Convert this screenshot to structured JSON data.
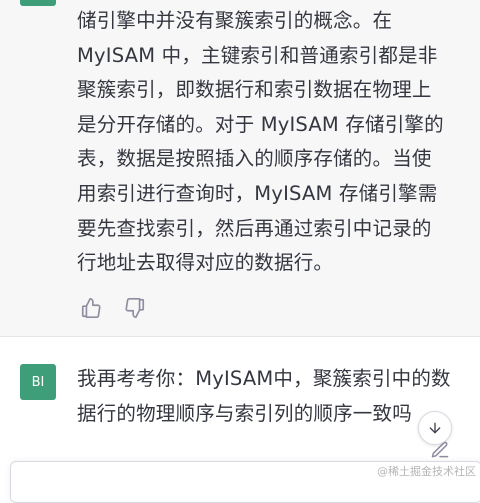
{
  "assistant": {
    "answer_lines": [
      "储引擎中并没有聚簇索引的概念。在",
      "MyISAM 中，主键索引和普通索引都是非",
      "聚簇索引，即数据行和索引数据在物理上",
      "是分开存储的。对于 MyISAM 存储引擎的",
      "表，数据是按照插入的顺序存储的。当使",
      "用索引进行查询时，MyISAM 存储引擎需",
      "要先查找索引，然后再通过索引中记录的",
      "行地址去取得对应的数据行。"
    ],
    "feedback_icons": [
      "thumbs-up-icon",
      "thumbs-down-icon"
    ]
  },
  "user": {
    "avatar_initials": "BI",
    "message_lines": [
      "我再考考你：MyISAM中，聚簇索引中的数",
      "据行的物理顺序与索引列的顺序一致吗"
    ]
  },
  "watermark": "@稀土掘金技术社区",
  "colors": {
    "accent": "#3e9e79",
    "assistant_bg": "#f7f7f8",
    "text": "#353740"
  }
}
